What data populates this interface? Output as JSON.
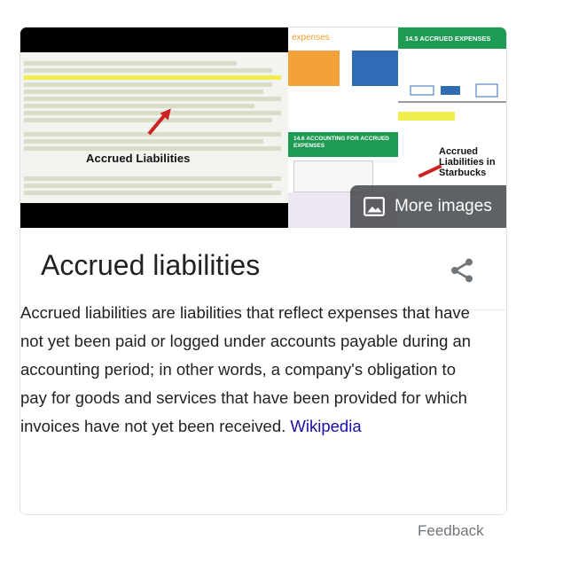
{
  "images": {
    "main_label": "Accrued Liabilities",
    "mid_heading": "expenses",
    "mid_green_banner": "14.6 ACCOUNTING FOR ACCRUED EXPENSES",
    "right_heading": "14.5 ACCRUED EXPENSES",
    "right_label": "Accrued Liabilities in Starbucks",
    "more_images_label": "More images"
  },
  "panel": {
    "title": "Accrued liabilities",
    "description": "Accrued liabilities are liabilities that reflect expenses that have not yet been paid or logged under accounts payable during an accounting period; in other words, a company's obligation to pay for goods and services that have been provided for which invoices have not yet been received.",
    "source_link": "Wikipedia",
    "share_icon": "share-icon"
  },
  "footer": {
    "feedback_label": "Feedback"
  }
}
